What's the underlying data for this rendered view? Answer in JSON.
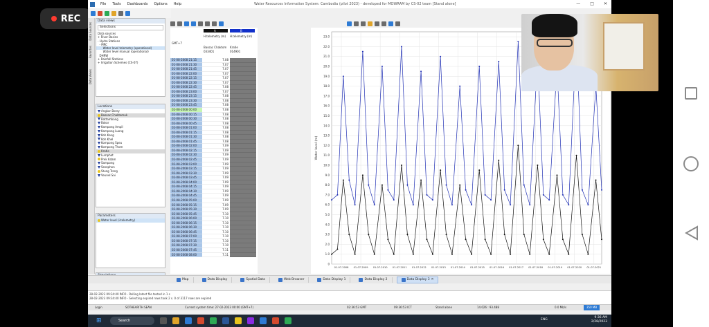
{
  "recording": {
    "label": "REC"
  },
  "window": {
    "title": "Water Resources Information System: Cambodia (pilot 2023) - developed for MOWRAM by CS-02 team  [Stand alone]",
    "menu": [
      "File",
      "Tools",
      "Dashboards",
      "Options",
      "Help"
    ]
  },
  "side_tabs": [
    "Data Sources",
    "Favorites",
    "Data Views"
  ],
  "data_sources": {
    "header": "Data views",
    "dropdown_value": "Selections",
    "section_label": "Data sources",
    "tree": [
      "+ River Basins",
      "- Hydro Stations",
      "  - MRC",
      "      Water level telemetry (operational)",
      "      Water level manual (operational)",
      "  DHRW",
      "+ Rainfall Stations",
      "+ Irrigation Schemes (CS-07)"
    ]
  },
  "locations": {
    "header": "Locations",
    "items": [
      {
        "name": "Angkor Borey",
        "icon": "tri",
        "state": ""
      },
      {
        "name": "Bassac Chaktomuk",
        "icon": "yel",
        "state": "gray"
      },
      {
        "name": "Battambang",
        "icon": "tri",
        "state": ""
      },
      {
        "name": "Bokor",
        "icon": "tri",
        "state": ""
      },
      {
        "name": "Kampong Ampil",
        "icon": "tri",
        "state": ""
      },
      {
        "name": "Kampong Luong",
        "icon": "tri",
        "state": ""
      },
      {
        "name": "Koh Kong",
        "icon": "tri",
        "state": ""
      },
      {
        "name": "Koh Khel",
        "icon": "tri",
        "state": ""
      },
      {
        "name": "Kompong Speu",
        "icon": "tri",
        "state": ""
      },
      {
        "name": "Kompong Thom",
        "icon": "tri",
        "state": ""
      },
      {
        "name": "Kratie",
        "icon": "yel",
        "state": "gray"
      },
      {
        "name": "Lumphat",
        "icon": "tri",
        "state": ""
      },
      {
        "name": "Prek Kdam",
        "icon": "yel",
        "state": ""
      },
      {
        "name": "Sampong",
        "icon": "tri",
        "state": ""
      },
      {
        "name": "Sesephon",
        "icon": "tri",
        "state": ""
      },
      {
        "name": "Stung Treng",
        "icon": "yel",
        "state": ""
      },
      {
        "name": "Veunel Sai",
        "icon": "tri",
        "state": ""
      }
    ]
  },
  "parameters": {
    "header": "Parameters",
    "selected": "Water level (i-telemetry)"
  },
  "simulations": {
    "header": "Simulations"
  },
  "table": {
    "timezone": "GMT+7",
    "col_a": {
      "letter": "A",
      "name": "H.telemetry (m)",
      "station": "Bassac Chaktom",
      "code": "033401"
    },
    "col_b": {
      "letter": "B",
      "name": "H.telemetry (m)",
      "station": "Kratie",
      "code": "014901"
    },
    "rows": [
      {
        "t": "01-08-2008 21:15",
        "a": "7.08"
      },
      {
        "t": "01-08-2008 21:30",
        "a": "7.07"
      },
      {
        "t": "01-08-2008 21:45",
        "a": "7.07"
      },
      {
        "t": "01-08-2008 22:00",
        "a": "7.07"
      },
      {
        "t": "01-08-2008 22:15",
        "a": "7.07"
      },
      {
        "t": "01-08-2008 22:30",
        "a": "7.07"
      },
      {
        "t": "01-08-2008 22:45",
        "a": "7.08"
      },
      {
        "t": "01-08-2008 23:00",
        "a": "7.07"
      },
      {
        "t": "01-08-2008 23:15",
        "a": "7.08"
      },
      {
        "t": "01-08-2008 23:30",
        "a": "7.08"
      },
      {
        "t": "01-08-2008 23:45",
        "a": "7.08"
      },
      {
        "t": "02-08-2008 00:00",
        "a": "7.08",
        "hl": true
      },
      {
        "t": "02-08-2008 00:15",
        "a": "7.08"
      },
      {
        "t": "02-08-2008 00:30",
        "a": "7.08"
      },
      {
        "t": "02-08-2008 00:45",
        "a": "7.08"
      },
      {
        "t": "02-08-2008 01:00",
        "a": "7.08"
      },
      {
        "t": "02-08-2008 01:15",
        "a": "7.08"
      },
      {
        "t": "02-08-2008 01:30",
        "a": "7.08"
      },
      {
        "t": "02-08-2008 01:45",
        "a": "7.08"
      },
      {
        "t": "02-08-2008 02:00",
        "a": "7.09"
      },
      {
        "t": "02-08-2008 02:15",
        "a": "7.09"
      },
      {
        "t": "02-08-2008 02:30",
        "a": "7.09"
      },
      {
        "t": "02-08-2008 02:45",
        "a": "7.09"
      },
      {
        "t": "02-08-2008 03:00",
        "a": "7.09"
      },
      {
        "t": "02-08-2008 03:15",
        "a": "7.09"
      },
      {
        "t": "02-08-2008 03:30",
        "a": "7.09"
      },
      {
        "t": "02-08-2008 03:45",
        "a": "7.09"
      },
      {
        "t": "02-08-2008 04:00",
        "a": "7.09"
      },
      {
        "t": "02-08-2008 04:15",
        "a": "7.09"
      },
      {
        "t": "02-08-2008 04:30",
        "a": "7.09"
      },
      {
        "t": "02-08-2008 04:45",
        "a": "7.09"
      },
      {
        "t": "02-08-2008 05:00",
        "a": "7.09"
      },
      {
        "t": "02-08-2008 05:15",
        "a": "7.09"
      },
      {
        "t": "02-08-2008 05:30",
        "a": "7.09"
      },
      {
        "t": "02-08-2008 05:45",
        "a": "7.10"
      },
      {
        "t": "02-08-2008 06:00",
        "a": "7.10"
      },
      {
        "t": "02-08-2008 06:15",
        "a": "7.10"
      },
      {
        "t": "02-08-2008 06:30",
        "a": "7.10"
      },
      {
        "t": "02-08-2008 06:45",
        "a": "7.10"
      },
      {
        "t": "02-08-2008 07:00",
        "a": "7.10"
      },
      {
        "t": "02-08-2008 07:15",
        "a": "7.10"
      },
      {
        "t": "02-08-2008 07:30",
        "a": "7.10"
      },
      {
        "t": "02-08-2008 07:45",
        "a": "7.11"
      },
      {
        "t": "02-08-2008 08:00",
        "a": "7.11"
      }
    ]
  },
  "chart_data": {
    "type": "line",
    "ylabel": "Water level (m)",
    "ylim": [
      0,
      23.5
    ],
    "y_ticks": [
      "0",
      "1.0",
      "2.0",
      "3.0",
      "4.0",
      "5.0",
      "6.0",
      "7.0",
      "8.0",
      "9.0",
      "10.0",
      "11.0",
      "12.0",
      "13.0",
      "14.0",
      "15.0",
      "16.0",
      "17.0",
      "18.0",
      "19.0",
      "20.0",
      "21.0",
      "22.0",
      "23.0"
    ],
    "x_ticks": [
      "01-07-2008",
      "01-07-2009",
      "01-07-2010",
      "01-07-2011",
      "01-07-2012",
      "01-07-2013",
      "01-07-2014",
      "01-07-2015",
      "01-07-2016",
      "01-07-2017",
      "01-07-2018",
      "01-07-2019",
      "01-07-2020",
      "01-07-2021"
    ],
    "series": [
      {
        "color": "#1f2fb4",
        "x": [
          2008.0,
          2008.3,
          2008.6,
          2008.9,
          2009.2,
          2009.6,
          2009.9,
          2010.2,
          2010.6,
          2010.9,
          2011.2,
          2011.6,
          2011.9,
          2012.2,
          2012.6,
          2012.9,
          2013.2,
          2013.6,
          2013.9,
          2014.2,
          2014.6,
          2014.9,
          2015.2,
          2015.6,
          2015.9,
          2016.2,
          2016.6,
          2016.9,
          2017.2,
          2017.6,
          2017.9,
          2018.2,
          2018.6,
          2018.9,
          2019.2,
          2019.6,
          2019.9,
          2020.2,
          2020.6,
          2020.9,
          2021.2,
          2021.6,
          2021.9
        ],
        "values": [
          6.5,
          7.0,
          19.0,
          8.5,
          6.0,
          21.5,
          8.0,
          6.0,
          20.0,
          7.5,
          6.5,
          22.0,
          8.0,
          6.0,
          19.5,
          7.0,
          6.5,
          21.0,
          8.0,
          6.0,
          18.0,
          7.5,
          6.0,
          20.0,
          7.0,
          6.5,
          20.5,
          7.5,
          6.0,
          22.5,
          8.0,
          6.0,
          21.0,
          7.0,
          6.5,
          20.0,
          7.0,
          6.0,
          23.0,
          7.5,
          6.0,
          18.0,
          7.5
        ]
      },
      {
        "color": "#111111",
        "x": [
          2008.0,
          2008.3,
          2008.6,
          2008.9,
          2009.2,
          2009.6,
          2009.9,
          2010.2,
          2010.6,
          2010.9,
          2011.2,
          2011.6,
          2011.9,
          2012.2,
          2012.6,
          2012.9,
          2013.2,
          2013.6,
          2013.9,
          2014.2,
          2014.6,
          2014.9,
          2015.2,
          2015.6,
          2015.9,
          2016.2,
          2016.6,
          2016.9,
          2017.2,
          2017.6,
          2017.9,
          2018.2,
          2018.6,
          2018.9,
          2019.2,
          2019.6,
          2019.9,
          2020.2,
          2020.6,
          2020.9,
          2021.2,
          2021.6,
          2021.9
        ],
        "values": [
          1.0,
          1.5,
          8.5,
          3.0,
          1.0,
          9.0,
          3.0,
          1.0,
          8.0,
          2.5,
          1.0,
          10.0,
          3.0,
          1.0,
          8.5,
          2.5,
          1.0,
          9.5,
          3.0,
          1.0,
          8.0,
          2.5,
          1.0,
          9.5,
          2.5,
          1.0,
          10.5,
          3.0,
          1.0,
          12.0,
          3.0,
          1.0,
          10.0,
          2.5,
          1.0,
          9.0,
          2.5,
          1.0,
          11.0,
          3.0,
          1.0,
          8.5,
          2.5
        ]
      }
    ]
  },
  "bottom_tabs": [
    "Map",
    "Data Display",
    "Spatial Data",
    "Web Browser",
    "Data Display 1",
    "Data Display 2",
    "Data Display 3"
  ],
  "active_tab": "Data Display 3",
  "log": {
    "line1": "28-02-2023 09:34:40 INFO - Rolling latest file tested in 1 s",
    "line2": "28-02-2023 09:34:40 INFO - Selecting expired rows took 2 s. 0 of 3117 rows are expired"
  },
  "status": {
    "login": "Login",
    "user": "SOTHEARITH SEAN",
    "current_time": "Current system time: 27-02-2023 00:00 (GMT+7)",
    "gmt": "02:36:53 GMT",
    "ict": "09:36:53 ICT",
    "mode": "Stand alone",
    "coords": "14.026 : 93.488",
    "rate": "0.0 Mb/s",
    "memory": "350 MB"
  },
  "taskbar": {
    "search": "Search",
    "lang": "ENG",
    "time": "9:36 AM",
    "date": "2/28/2023"
  }
}
